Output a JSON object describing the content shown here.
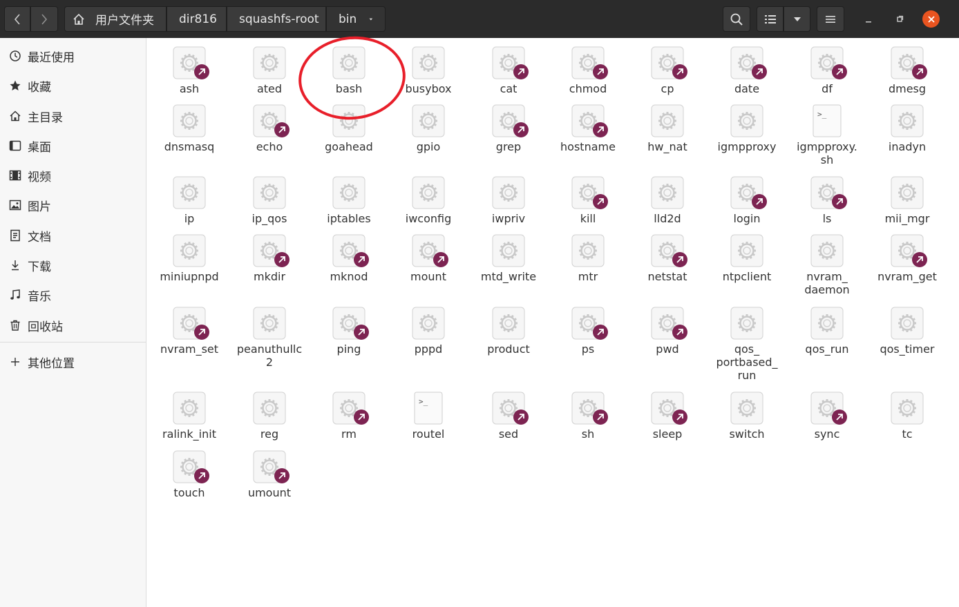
{
  "header": {
    "breadcrumbs": [
      "用户文件夹",
      "dir816",
      "squashfs-root",
      "bin"
    ],
    "nav_back_icon": "chevron-left-icon",
    "nav_forward_icon": "chevron-right-icon",
    "home_icon": "home-icon",
    "search_icon": "search-icon",
    "view_icon": "list-view-icon",
    "menu_icon": "hamburger-menu-icon",
    "colors": {
      "bar": "#2b2b2b",
      "close": "#e95420"
    }
  },
  "sidebar": {
    "items": [
      {
        "label": "最近使用",
        "icon": "clock-icon"
      },
      {
        "label": "收藏",
        "icon": "star-icon"
      },
      {
        "label": "主目录",
        "icon": "home-icon"
      },
      {
        "label": "桌面",
        "icon": "desktop-icon"
      },
      {
        "label": "视频",
        "icon": "film-icon"
      },
      {
        "label": "图片",
        "icon": "picture-icon"
      },
      {
        "label": "文档",
        "icon": "document-icon"
      },
      {
        "label": "下载",
        "icon": "download-icon"
      },
      {
        "label": "音乐",
        "icon": "music-icon"
      },
      {
        "label": "回收站",
        "icon": "trash-icon"
      }
    ],
    "other": {
      "label": "其他位置",
      "icon": "plus-icon"
    }
  },
  "files": [
    {
      "name": "ash",
      "type": "exec",
      "link": true
    },
    {
      "name": "ated",
      "type": "exec",
      "link": false
    },
    {
      "name": "bash",
      "type": "exec",
      "link": false
    },
    {
      "name": "busybox",
      "type": "exec",
      "link": false
    },
    {
      "name": "cat",
      "type": "exec",
      "link": true
    },
    {
      "name": "chmod",
      "type": "exec",
      "link": true
    },
    {
      "name": "cp",
      "type": "exec",
      "link": true
    },
    {
      "name": "date",
      "type": "exec",
      "link": true
    },
    {
      "name": "df",
      "type": "exec",
      "link": true
    },
    {
      "name": "dmesg",
      "type": "exec",
      "link": true
    },
    {
      "name": "dnsmasq",
      "type": "exec",
      "link": false
    },
    {
      "name": "echo",
      "type": "exec",
      "link": true
    },
    {
      "name": "goahead",
      "type": "exec",
      "link": false
    },
    {
      "name": "gpio",
      "type": "exec",
      "link": false
    },
    {
      "name": "grep",
      "type": "exec",
      "link": true
    },
    {
      "name": "hostname",
      "type": "exec",
      "link": true
    },
    {
      "name": "hw_nat",
      "type": "exec",
      "link": false
    },
    {
      "name": "igmpproxy",
      "type": "exec",
      "link": false
    },
    {
      "name": "igmpproxy.\nsh",
      "type": "script",
      "link": false
    },
    {
      "name": "inadyn",
      "type": "exec",
      "link": false
    },
    {
      "name": "ip",
      "type": "exec",
      "link": false
    },
    {
      "name": "ip_qos",
      "type": "exec",
      "link": false
    },
    {
      "name": "iptables",
      "type": "exec",
      "link": false
    },
    {
      "name": "iwconfig",
      "type": "exec",
      "link": false
    },
    {
      "name": "iwpriv",
      "type": "exec",
      "link": false
    },
    {
      "name": "kill",
      "type": "exec",
      "link": true
    },
    {
      "name": "lld2d",
      "type": "exec",
      "link": false
    },
    {
      "name": "login",
      "type": "exec",
      "link": true
    },
    {
      "name": "ls",
      "type": "exec",
      "link": true
    },
    {
      "name": "mii_mgr",
      "type": "exec",
      "link": false
    },
    {
      "name": "miniupnpd",
      "type": "exec",
      "link": false
    },
    {
      "name": "mkdir",
      "type": "exec",
      "link": true
    },
    {
      "name": "mknod",
      "type": "exec",
      "link": true
    },
    {
      "name": "mount",
      "type": "exec",
      "link": true
    },
    {
      "name": "mtd_write",
      "type": "exec",
      "link": false
    },
    {
      "name": "mtr",
      "type": "exec",
      "link": false
    },
    {
      "name": "netstat",
      "type": "exec",
      "link": true
    },
    {
      "name": "ntpclient",
      "type": "exec",
      "link": false
    },
    {
      "name": "nvram_\ndaemon",
      "type": "exec",
      "link": false
    },
    {
      "name": "nvram_get",
      "type": "exec",
      "link": true
    },
    {
      "name": "nvram_set",
      "type": "exec",
      "link": true
    },
    {
      "name": "peanuthullc\n2",
      "type": "exec",
      "link": false
    },
    {
      "name": "ping",
      "type": "exec",
      "link": true
    },
    {
      "name": "pppd",
      "type": "exec",
      "link": false
    },
    {
      "name": "product",
      "type": "exec",
      "link": false
    },
    {
      "name": "ps",
      "type": "exec",
      "link": true
    },
    {
      "name": "pwd",
      "type": "exec",
      "link": true
    },
    {
      "name": "qos_\nportbased_\nrun",
      "type": "exec",
      "link": false
    },
    {
      "name": "qos_run",
      "type": "exec",
      "link": false
    },
    {
      "name": "qos_timer",
      "type": "exec",
      "link": false
    },
    {
      "name": "ralink_init",
      "type": "exec",
      "link": false
    },
    {
      "name": "reg",
      "type": "exec",
      "link": false
    },
    {
      "name": "rm",
      "type": "exec",
      "link": true
    },
    {
      "name": "routel",
      "type": "script",
      "link": false
    },
    {
      "name": "sed",
      "type": "exec",
      "link": true
    },
    {
      "name": "sh",
      "type": "exec",
      "link": true
    },
    {
      "name": "sleep",
      "type": "exec",
      "link": true
    },
    {
      "name": "switch",
      "type": "exec",
      "link": false
    },
    {
      "name": "sync",
      "type": "exec",
      "link": true
    },
    {
      "name": "tc",
      "type": "exec",
      "link": false
    },
    {
      "name": "touch",
      "type": "exec",
      "link": true
    },
    {
      "name": "umount",
      "type": "exec",
      "link": true
    }
  ],
  "colors": {
    "link_badge": "#7d2452",
    "highlight": "#e81f2a"
  }
}
